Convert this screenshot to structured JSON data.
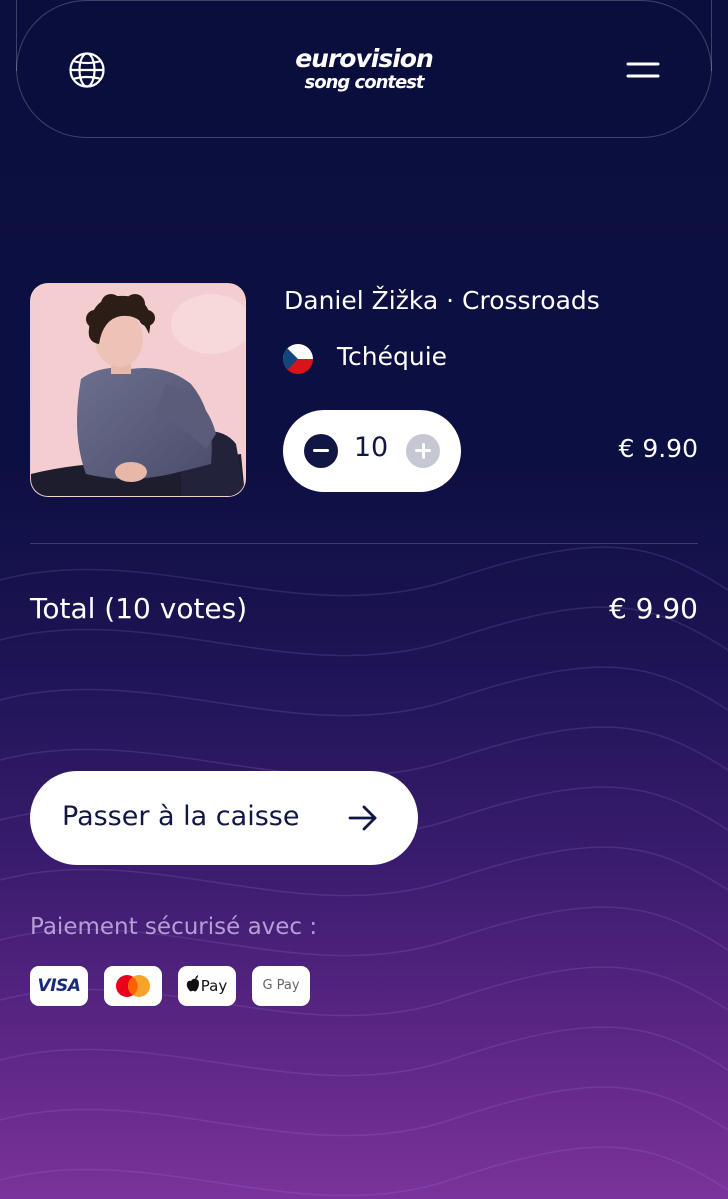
{
  "header": {
    "logo_line1": "eurovision",
    "logo_line2": "song contest",
    "language_icon": "globe-icon",
    "menu_icon": "hamburger-menu-icon"
  },
  "item": {
    "image_icon": "artist-photo",
    "song": "Daniel Žižka · Crossroads",
    "country": "Tchéquie",
    "flag_icon": "czech-flag-icon",
    "quantity": "10",
    "price": "€ 9.90"
  },
  "summary": {
    "total_label": "Total (10 votes)",
    "total_value": "€ 9.90"
  },
  "checkout": {
    "label": "Passer à la caisse",
    "arrow_icon": "arrow-right-icon"
  },
  "payment": {
    "secure_text": "Paiement sécurisé avec :",
    "methods": [
      "VISA",
      "Mastercard",
      "Pay",
      "G Pay"
    ]
  },
  "colors": {
    "background_top": "#0b0f3f",
    "background_bottom": "#7a339a",
    "dark_navy": "#121645",
    "button_white": "#ffffff"
  }
}
